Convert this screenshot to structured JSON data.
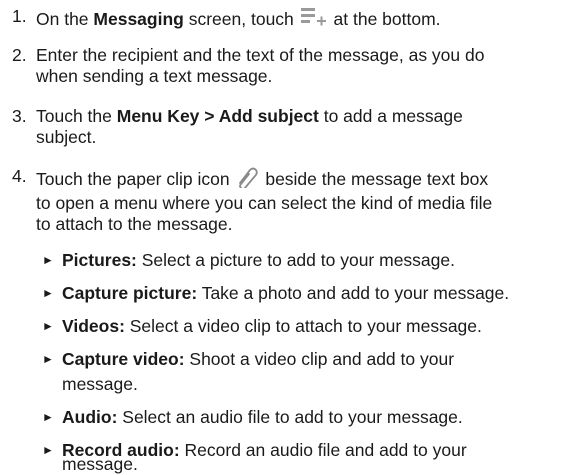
{
  "steps": [
    {
      "num": "1.",
      "pre": "On the ",
      "bold": "Messaging",
      "mid": " screen, touch ",
      "post": " at the bottom."
    },
    {
      "num": "2.",
      "line1": "Enter the recipient and the text of the message, as you do",
      "line2": "when sending a text message."
    },
    {
      "num": "3.",
      "pre": "Touch the ",
      "bold": "Menu Key > Add subject",
      "post": " to add a message",
      "line2": "subject."
    },
    {
      "num": "4.",
      "pre": "Touch the paper clip icon ",
      "post": " beside the message text box",
      "line2": "to open a menu where you can select the kind of media file",
      "line3": "to attach to the message."
    }
  ],
  "bullets": [
    {
      "label": "Pictures:",
      "text": " Select a picture to add to your message."
    },
    {
      "label": "Capture picture:",
      "text": " Take a photo and add to your message."
    },
    {
      "label": "Videos:",
      "text": " Select a video clip to attach to your message."
    },
    {
      "label": "Capture video:",
      "text": " Shoot a video clip and add to your",
      "cont": "message."
    },
    {
      "label": "Audio:",
      "text": " Select an audio file to add to your message."
    },
    {
      "label": "Record audio:",
      "text": " Record an audio file and add to your",
      "cont": "message."
    }
  ],
  "arrow": "►",
  "icons": {
    "compose": "new-message-icon",
    "attach": "paperclip-icon"
  }
}
